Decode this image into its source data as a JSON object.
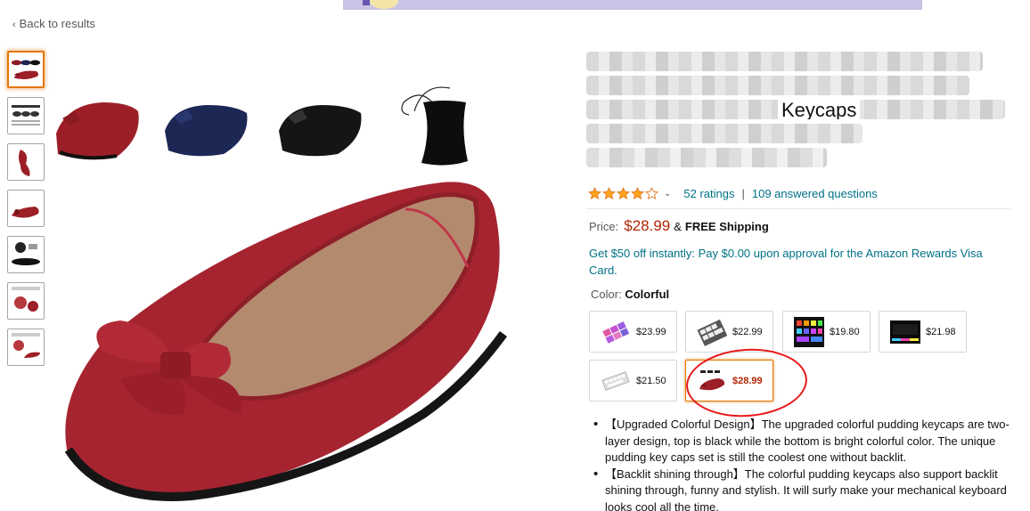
{
  "nav": {
    "back_label": "Back to results",
    "back_chevron": "‹"
  },
  "product": {
    "title_visible_word": "Keycaps",
    "rating_value": 4,
    "ratings_text": "52 ratings",
    "separator": "|",
    "questions_text": "109 answered questions",
    "price_label": "Price:",
    "price": "$28.99",
    "shipping_amp": "&",
    "shipping": "FREE Shipping",
    "promo": "Get $50 off instantly: Pay $0.00 upon approval for the Amazon Rewards Visa Card.",
    "color_label": "Color:",
    "color_value": "Colorful"
  },
  "swatches": [
    {
      "price": "$23.99",
      "image": "pink-keycaps",
      "selected": false
    },
    {
      "price": "$22.99",
      "image": "white-keycaps",
      "selected": false
    },
    {
      "price": "$19.80",
      "image": "rgb-keycaps",
      "selected": false
    },
    {
      "price": "$21.98",
      "image": "black-rgb-keycaps",
      "selected": false
    },
    {
      "price": "$21.50",
      "image": "white-keyboard",
      "selected": false
    },
    {
      "price": "$28.99",
      "image": "red-shoe",
      "selected": true
    }
  ],
  "bullets": [
    "【Upgraded Colorful Design】The upgraded colorful pudding keycaps are two-layer design, top is black while the bottom is bright colorful color. The unique pudding key caps set is still the coolest one without backlit.",
    "【Backlit shining through】The colorful pudding keycaps also support backlit shining through, funny and stylish. It will surly make your mechanical keyboard looks cool all the time."
  ],
  "colors": {
    "price_red": "#b12704",
    "link_teal": "#007185",
    "star": "#ffa41c",
    "annotation_red": "#e8181a",
    "selected_border": "#e77600"
  }
}
